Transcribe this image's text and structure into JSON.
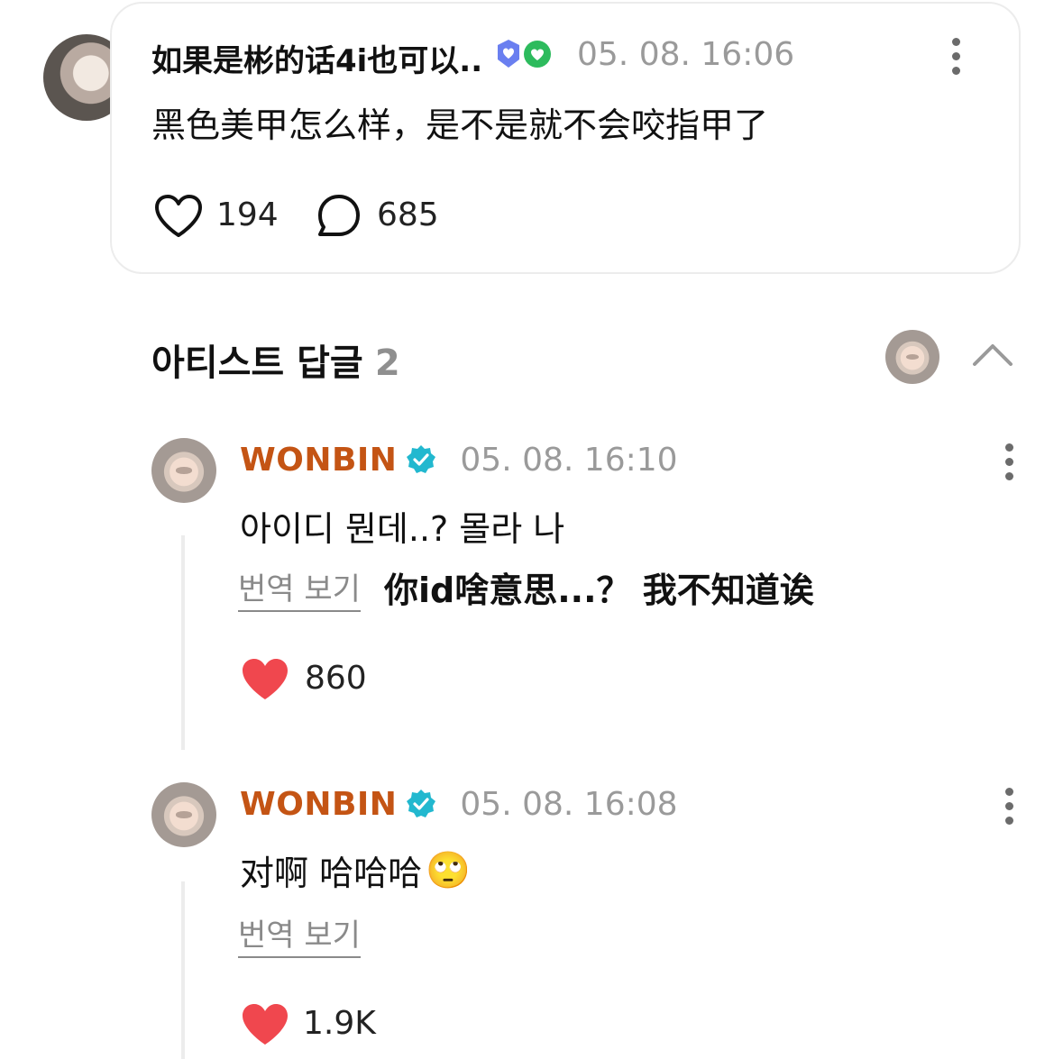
{
  "post": {
    "author": "如果是彬的话4i也可以..",
    "badges": [
      "blue-heart-badge",
      "green-heart-badge"
    ],
    "timestamp": "05. 08. 16:06",
    "text": "黑色美甲怎么样，是不是就不会咬指甲了",
    "likes": "194",
    "comments": "685"
  },
  "section": {
    "title": "아티스트 답글",
    "count": "2"
  },
  "replies": [
    {
      "author": "WONBIN",
      "timestamp": "05. 08. 16:10",
      "text": "아이디 뭔데..? 몰라 나",
      "translate_label": "번역 보기",
      "translation_overlay": "你id啥意思...？ 我不知道诶",
      "likes": "860"
    },
    {
      "author": "WONBIN",
      "timestamp": "05. 08. 16:08",
      "text": "对啊 哈哈哈",
      "emoji": "🙄",
      "translate_label": "번역 보기",
      "likes": "1.9K"
    }
  ],
  "colors": {
    "artist_name": "#c45414",
    "verified_badge": "#22b8cf",
    "heart_filled": "#f0474e",
    "muted_text": "#9a9a9a"
  }
}
